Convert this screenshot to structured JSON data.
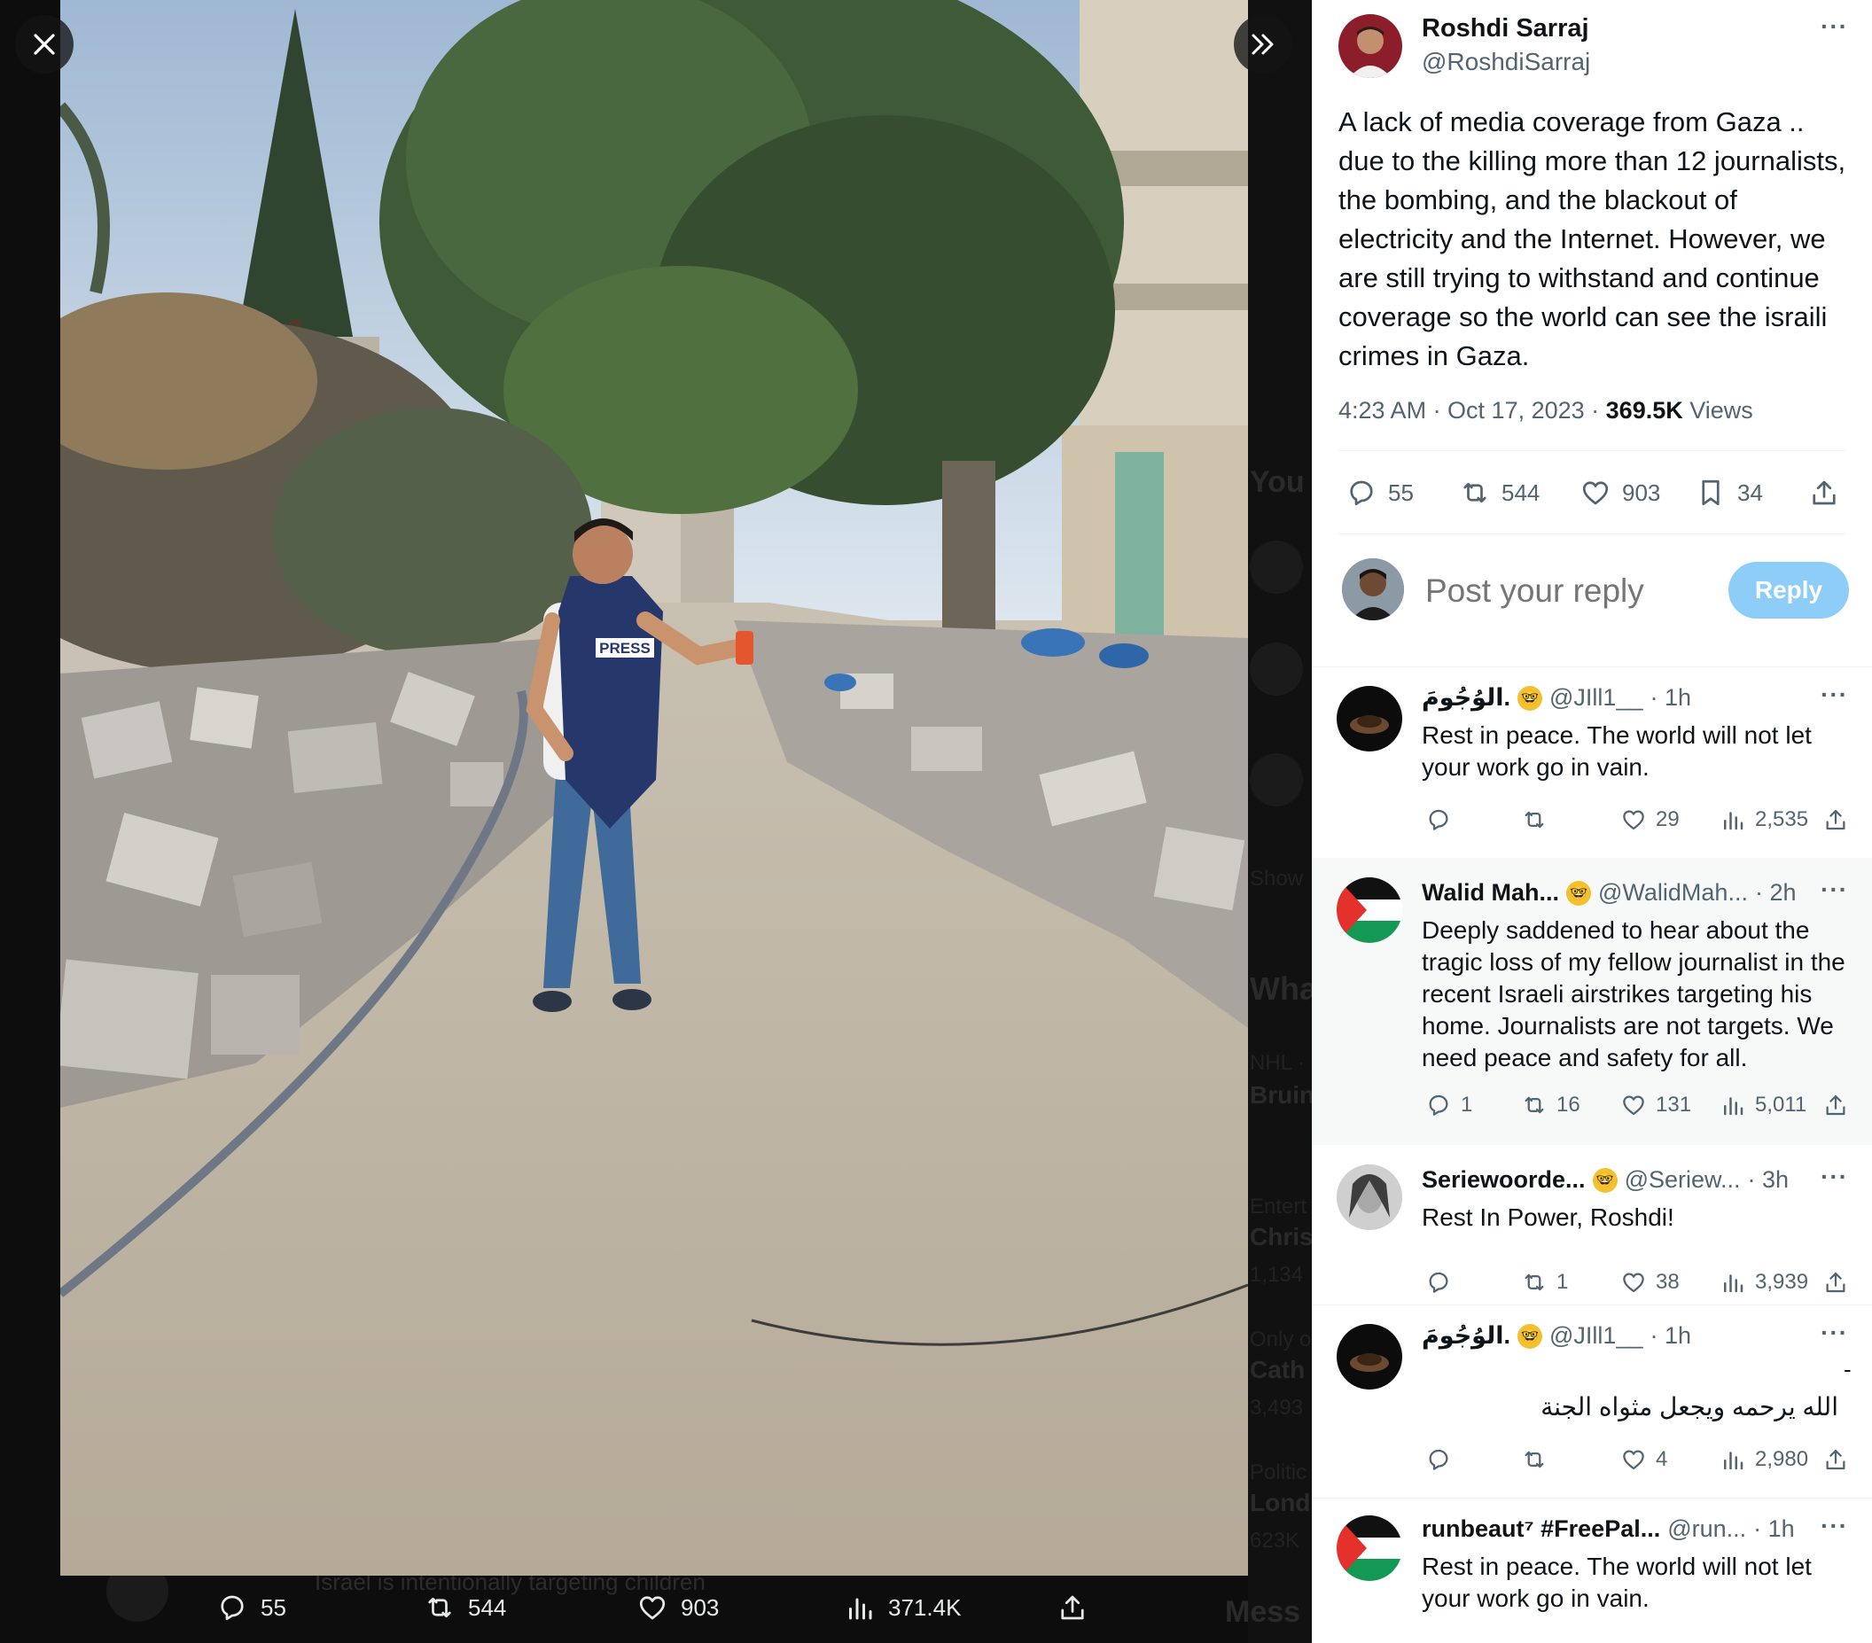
{
  "viewer": {
    "photo_text": "PRESS",
    "media_actions": {
      "replies": "55",
      "reposts": "544",
      "likes": "903",
      "views": "371.4K"
    }
  },
  "background_ghost": {
    "you": "You",
    "show": "Show",
    "what": "Wha",
    "nhl": "NHL ·",
    "bruins": "Bruin",
    "enter": "Entert",
    "chris": "Chris",
    "count1": "1,134",
    "only": "Only o",
    "cath": "Cath",
    "count2": "3,493",
    "politic": "Politic",
    "lond": "Lond",
    "count3": "623K",
    "mess": "Mess",
    "bottom_text": "Israel is intentionally targeting children"
  },
  "tweet": {
    "author_name": "Roshdi Sarraj",
    "author_handle": "@RoshdiSarraj",
    "text": "A lack of media coverage from Gaza .. due to the killing more than 12 journalists, the bombing, and the blackout of electricity and the Internet. However, we are still trying to withstand and continue coverage so the world can see the israili crimes in Gaza.",
    "time": "4:23 AM · Oct 17, 2023 · ",
    "views_count": "369.5K",
    "views_label": " Views",
    "actions": {
      "replies": "55",
      "reposts": "544",
      "likes": "903",
      "bookmarks": "34"
    }
  },
  "reply_box": {
    "placeholder": "Post your reply",
    "button": "Reply"
  },
  "replies": [
    {
      "name": "الوُجُومَ.",
      "handle": "@JIll1__",
      "time": "· 1h",
      "text": "Rest in peace. The world will not let your work go in vain.",
      "replies": "",
      "reposts": "",
      "likes": "29",
      "views": "2,535"
    },
    {
      "name": "Walid Mah...",
      "handle": "@WalidMah...",
      "time": "· 2h",
      "text": "Deeply saddened to hear about the tragic loss of my fellow journalist in the recent Israeli airstrikes targeting his home. Journalists are not targets. We need peace and safety for all.",
      "replies": "1",
      "reposts": "16",
      "likes": "131",
      "views": "5,011"
    },
    {
      "name": "Seriewoorde...",
      "handle": "@Seriew...",
      "time": "· 3h",
      "text": "Rest In Power, Roshdi!",
      "replies": "",
      "reposts": "1",
      "likes": "38",
      "views": "3,939"
    },
    {
      "name": "الوُجُومَ.",
      "handle": "@JIll1__",
      "time": "· 1h",
      "text_dash": "-",
      "text": "الله يرحمه ويجعل مثواه الجنة",
      "replies": "",
      "reposts": "",
      "likes": "4",
      "views": "2,980"
    },
    {
      "name": "runbeaut⁷ #FreePal...",
      "handle": "@run...",
      "time": "· 1h",
      "text": "Rest in peace. The world will not let your work go in vain."
    }
  ],
  "colors": {
    "accent_disabled": "#8ecdf7",
    "secondary_text": "#536471",
    "primary_text": "#0f1419"
  }
}
